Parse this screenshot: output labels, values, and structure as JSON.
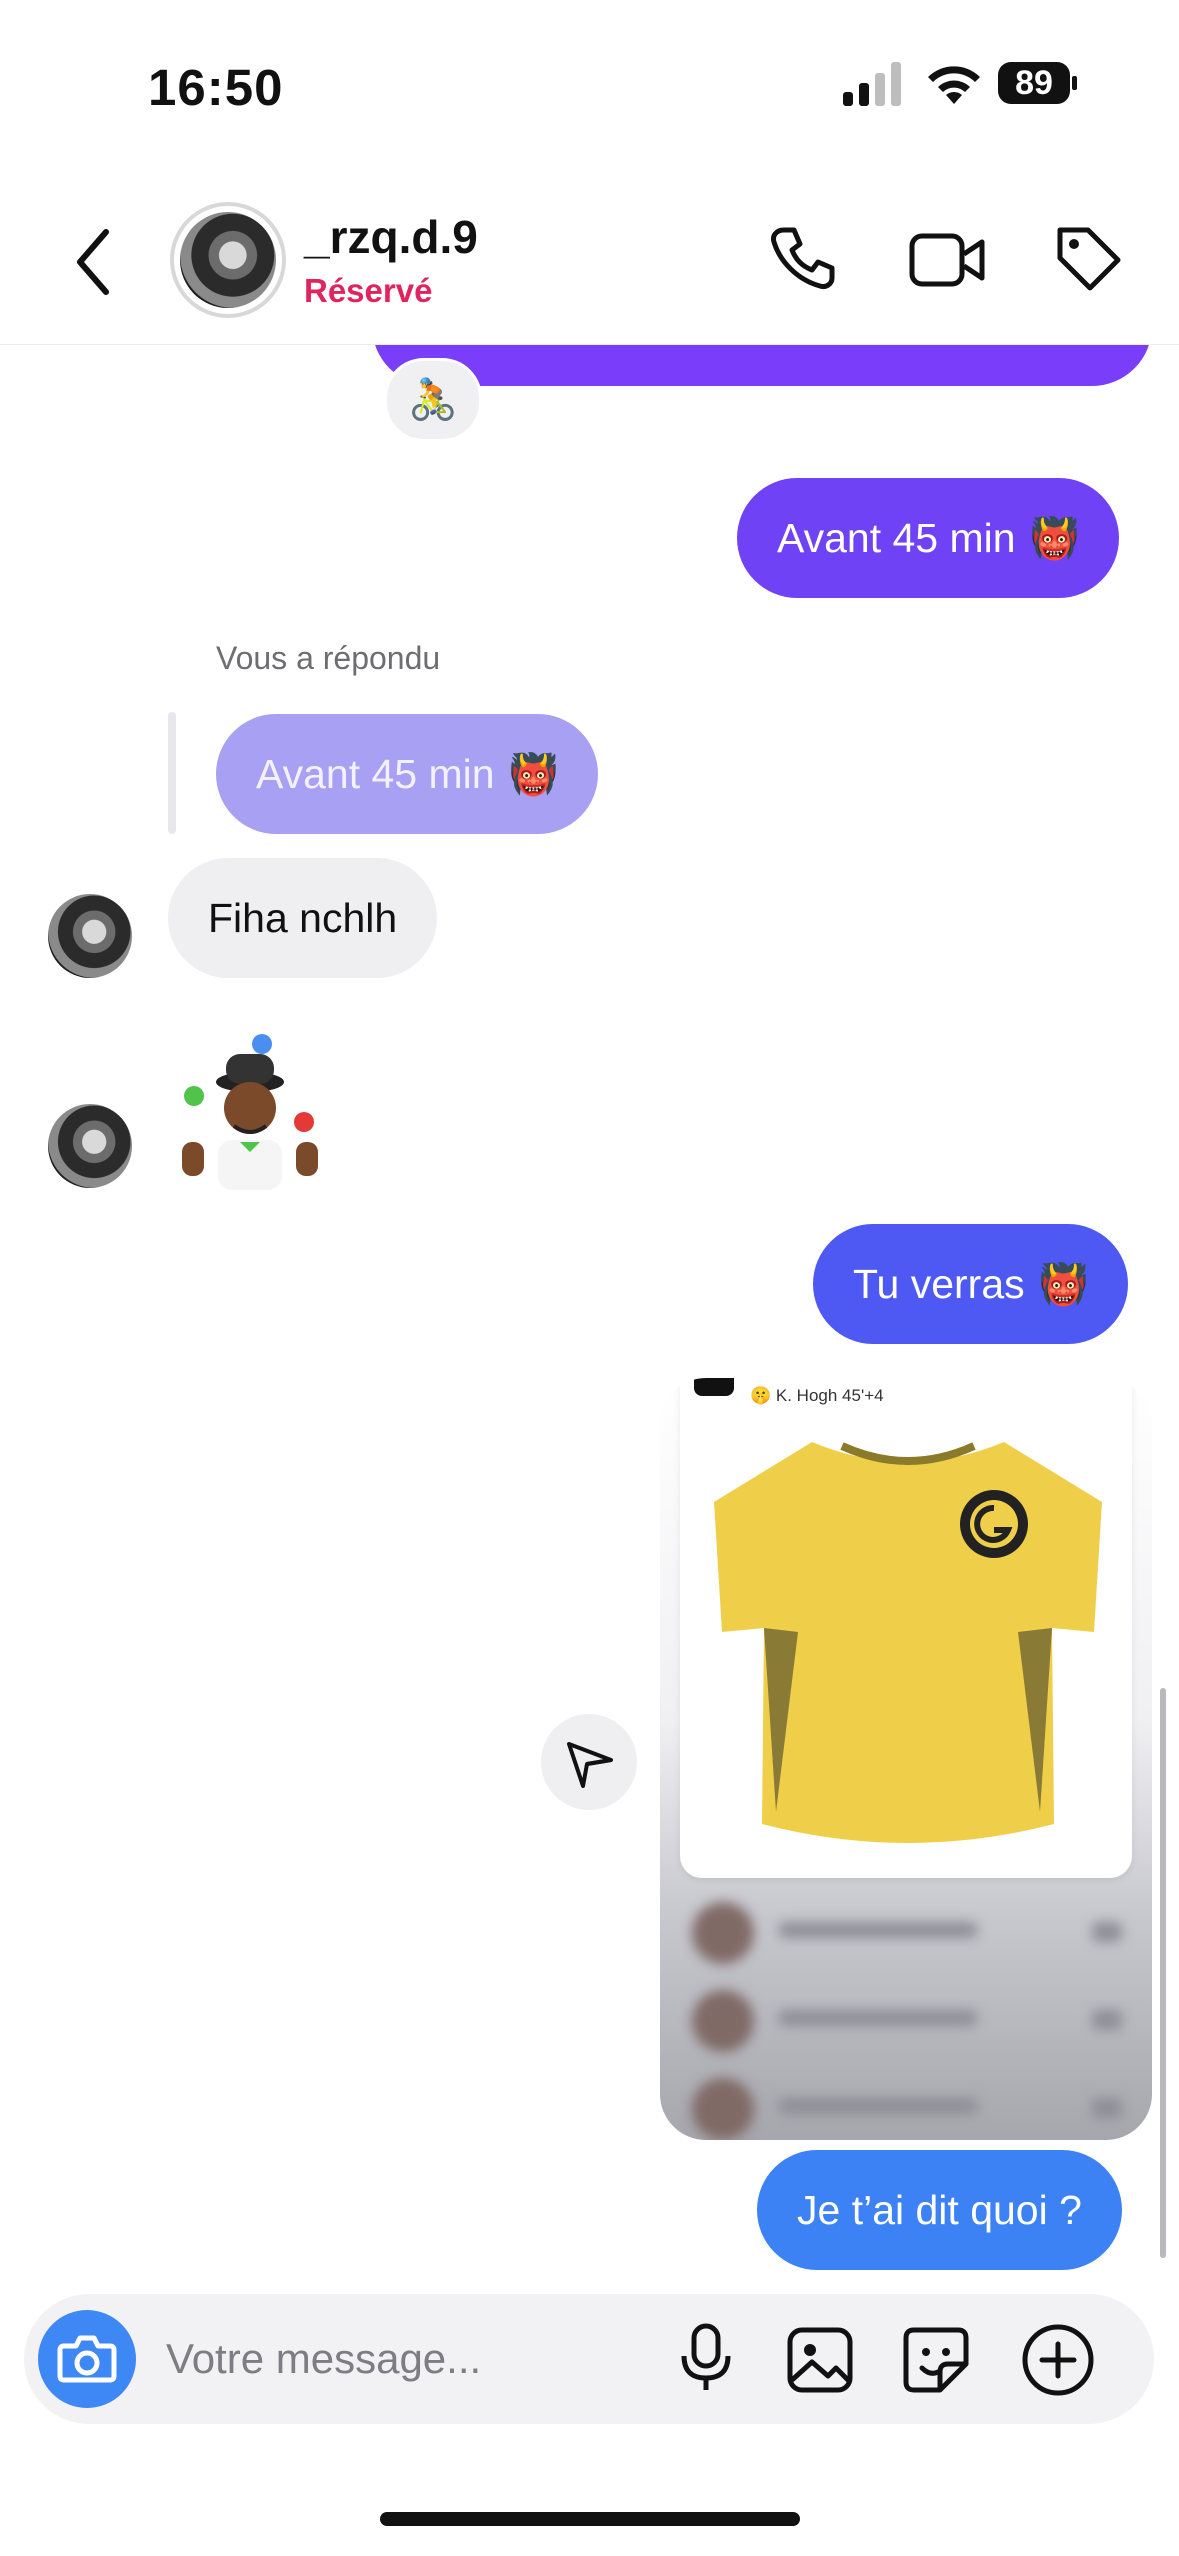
{
  "status_bar": {
    "time": "16:50",
    "battery": "89"
  },
  "header": {
    "contact_name": "_rzq.d.9",
    "contact_status": "Réservé"
  },
  "messages": {
    "reaction": "🚴",
    "avant": {
      "text": "Avant 45 min",
      "emoji": "👹"
    },
    "reply_label": "Vous a répondu",
    "reply_quote": {
      "text": "Avant 45 min",
      "emoji": "👹"
    },
    "fiha": "Fiha nchlh",
    "verras": {
      "text": "Tu verras",
      "emoji": "👹"
    },
    "shared_post_caption": "🤫 K. Hogh 45'+4",
    "dit": "Je t’ai dit quoi ?"
  },
  "composer": {
    "placeholder": "Votre message..."
  },
  "colors": {
    "accent_pink": "#e0245e",
    "bubble_purple": "#6f43f5",
    "bubble_indigo": "#4e59f3",
    "bubble_blue": "#3d82f4",
    "quote_lilac": "#a8a0f2",
    "jersey_yellow": "#efcf4a"
  },
  "icons": [
    "back-chevron-icon",
    "phone-icon",
    "video-camera-icon",
    "tag-icon",
    "send-icon",
    "camera-icon",
    "microphone-icon",
    "image-icon",
    "sticker-icon",
    "plus-circle-icon"
  ]
}
